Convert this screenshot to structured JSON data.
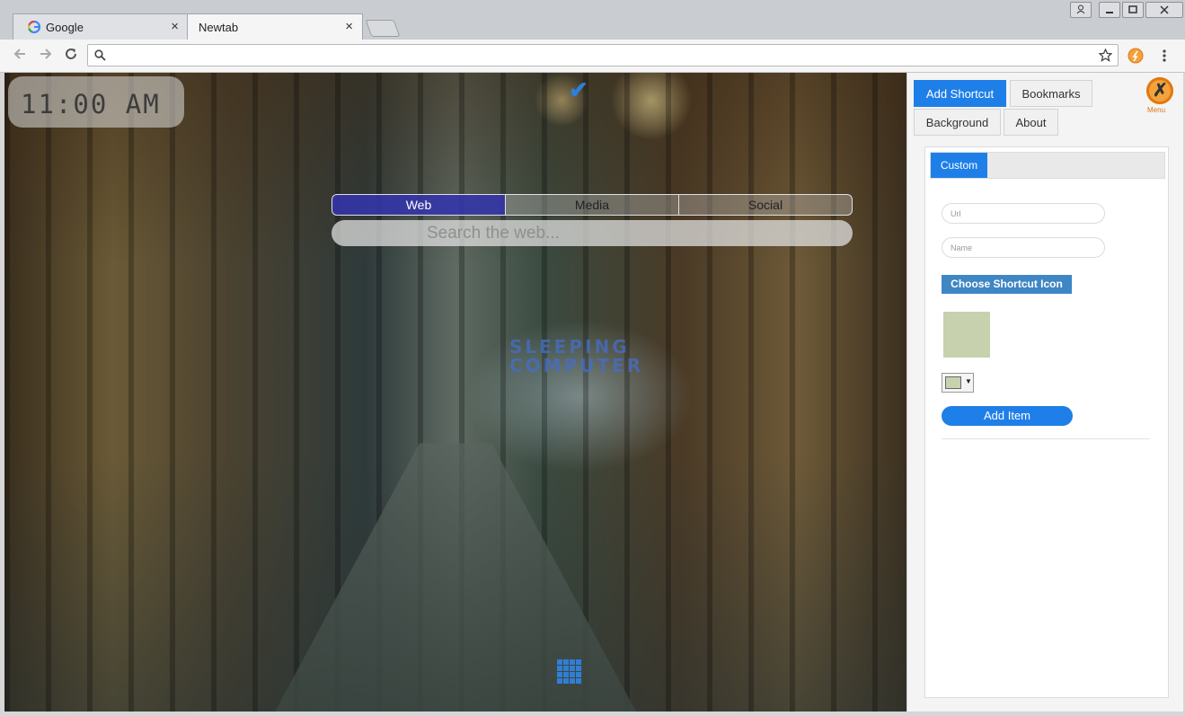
{
  "browser": {
    "tabs": [
      {
        "label": "Google",
        "icon": "google-icon",
        "active": false
      },
      {
        "label": "Newtab",
        "active": true
      }
    ],
    "tab_close_glyph": "×",
    "address": {
      "value": "",
      "placeholder": ""
    }
  },
  "page": {
    "clock": "11:00 AM",
    "search_tabs": [
      "Web",
      "Media",
      "Social"
    ],
    "active_search_tab": "Web",
    "search_placeholder": "Search the web...",
    "watermark_line1": "SLEEPING",
    "watermark_line2": "COMPUTER"
  },
  "panel": {
    "tabs": [
      "Add Shortcut",
      "Bookmarks",
      "Background",
      "About"
    ],
    "active_tab": "Add Shortcut",
    "menu_label": "Menu",
    "subtab": "Custom",
    "url_placeholder": "Url",
    "name_placeholder": "Name",
    "choose_icon_label": "Choose Shortcut Icon",
    "swatch_color": "#c7d1ae",
    "add_item_label": "Add Item"
  },
  "colors": {
    "accent": "#1f7fe8",
    "choose_button": "#3f86c4",
    "active_search_tab": "#2828aa"
  }
}
